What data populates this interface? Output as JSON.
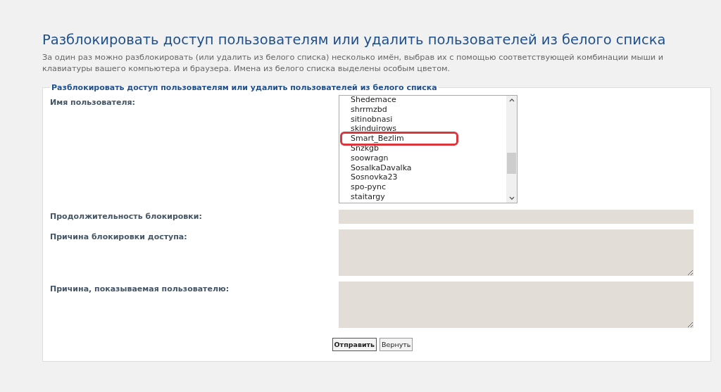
{
  "title": "Разблокировать доступ пользователям или удалить пользователей из белого списка",
  "description": "За один раз можно разблокировать (или удалить из белого списка) несколько имён, выбрав их с помощью соответствующей комбинации мыши и клавиатуры вашего компьютера и браузера. Имена из белого списка выделены особым цветом.",
  "form": {
    "legend": "Разблокировать доступ пользователям или удалить пользователей из белого списка",
    "fields": [
      {
        "kind": "list",
        "label": "Имя пользователя:",
        "items": [
          {
            "name": "Shedemace",
            "marked": false
          },
          {
            "name": "shrrmzbd",
            "marked": false
          },
          {
            "name": "sitinobnasi",
            "marked": false
          },
          {
            "name": "skinduirows",
            "marked": false
          },
          {
            "name": "Smart_Bezlim",
            "marked": true
          },
          {
            "name": "Snzkgb",
            "marked": false
          },
          {
            "name": "soowragn",
            "marked": false
          },
          {
            "name": "SosalkaDavalka",
            "marked": false
          },
          {
            "name": "Sosnovka23",
            "marked": false
          },
          {
            "name": "spo-pync",
            "marked": false
          },
          {
            "name": "staitargy",
            "marked": false
          }
        ]
      },
      {
        "kind": "input",
        "label": "Продолжительность блокировки:",
        "disabled": true
      },
      {
        "kind": "textarea",
        "label": "Причина блокировки доступа:",
        "disabled": true
      },
      {
        "kind": "textarea",
        "label": "Причина, показываемая пользователю:",
        "disabled": true
      }
    ],
    "buttons": [
      {
        "label": "Отправить",
        "primary": true
      },
      {
        "label": "Вернуть",
        "primary": false
      }
    ]
  }
}
